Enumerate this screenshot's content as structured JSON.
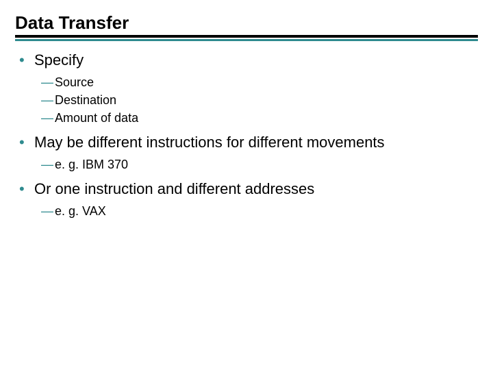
{
  "slide": {
    "title": "Data Transfer",
    "bullets": [
      {
        "text": "Specify",
        "subs": [
          "Source",
          "Destination",
          "Amount of data"
        ]
      },
      {
        "text": "May be different instructions for different movements",
        "subs": [
          "e. g. IBM 370"
        ]
      },
      {
        "text": "Or one instruction and different addresses",
        "subs": [
          "e. g. VAX"
        ]
      }
    ]
  },
  "glyphs": {
    "bullet": "•",
    "dash": "—"
  }
}
